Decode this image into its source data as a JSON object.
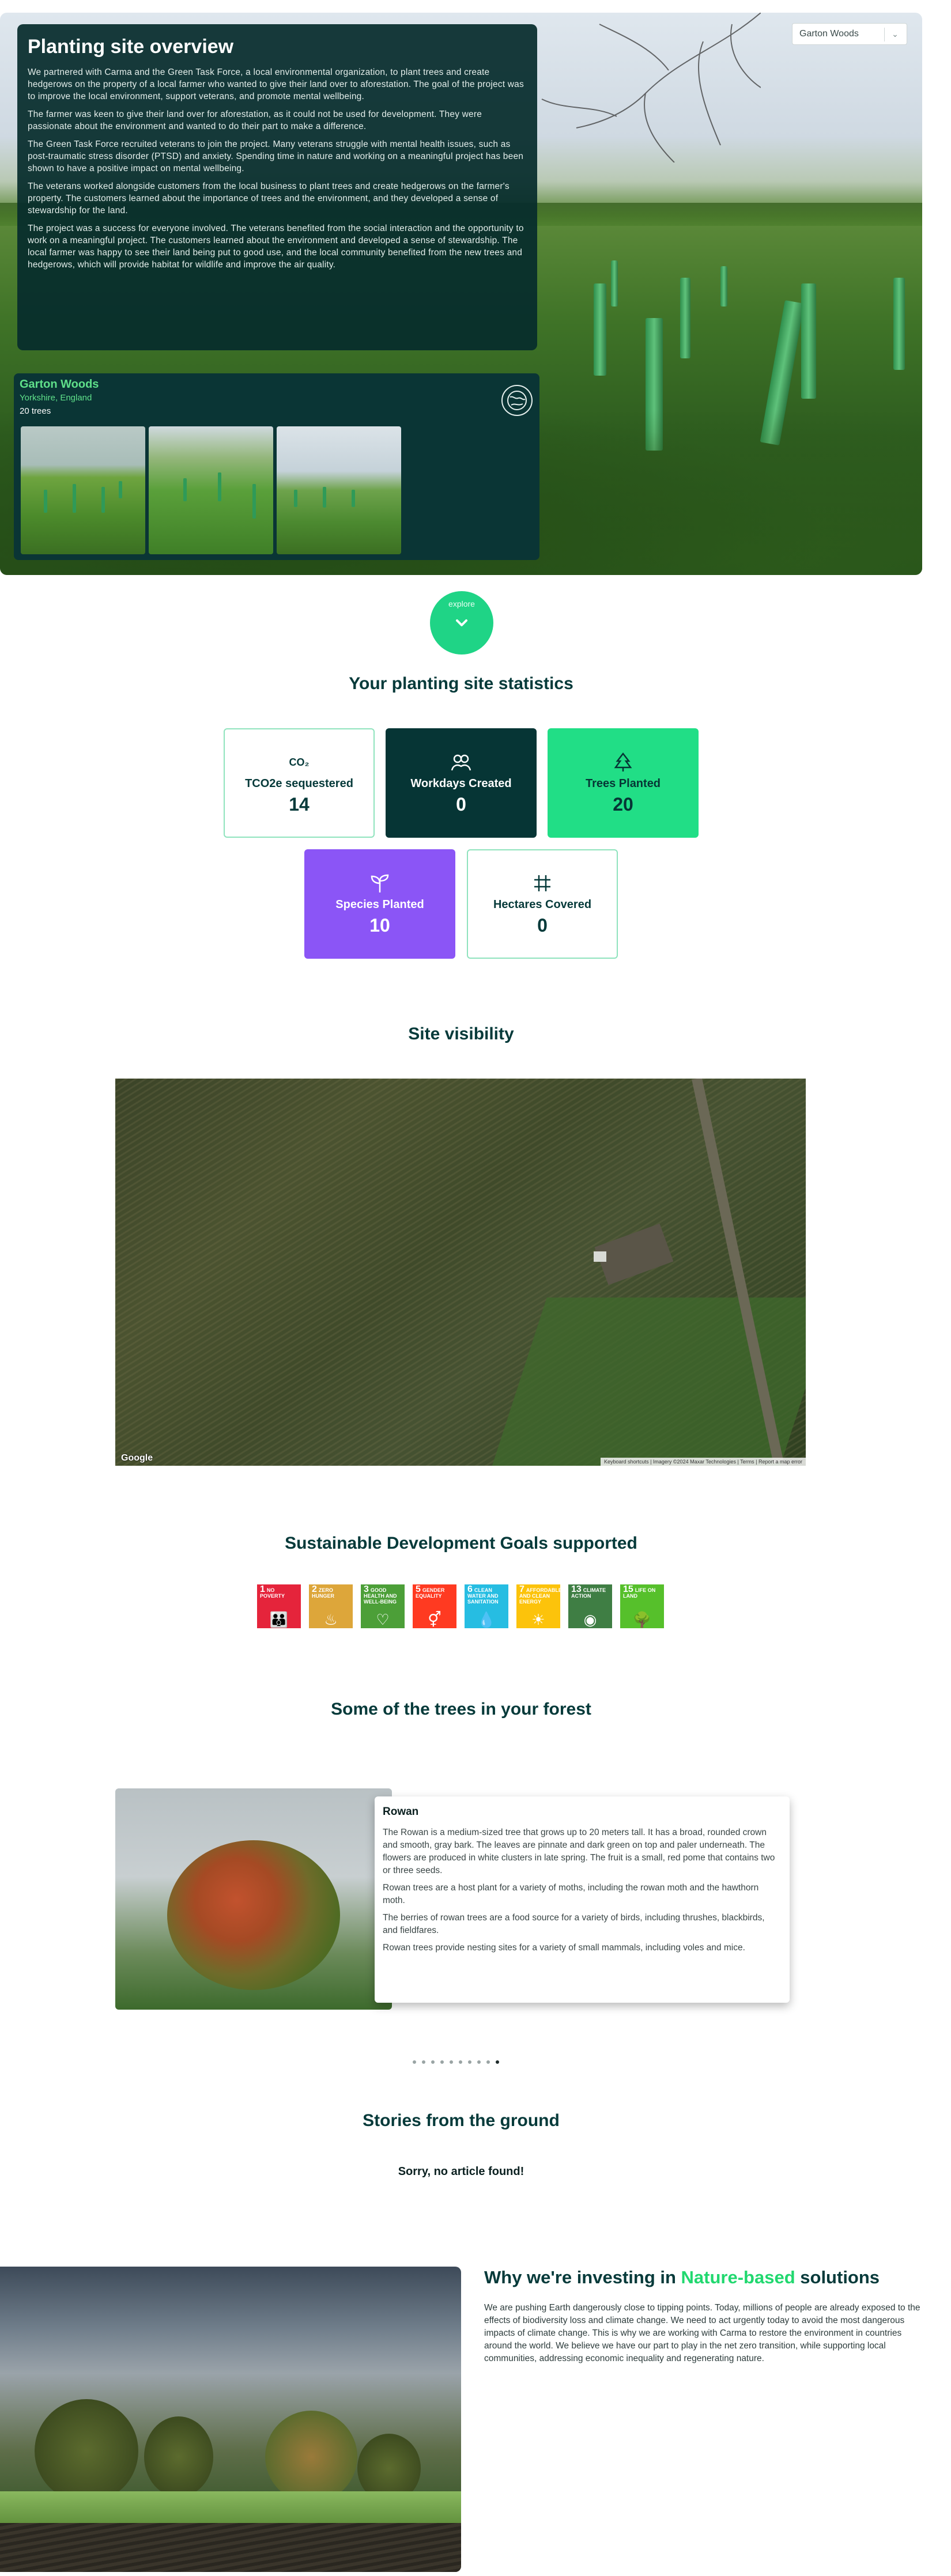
{
  "site_select": {
    "value": "Garton Woods"
  },
  "overview": {
    "title": "Planting site overview",
    "paragraphs": [
      "We partnered with Carma and the Green Task Force, a local environmental organization, to plant trees and create hedgerows on the property of a local farmer who wanted to give their land over to aforestation. The goal of the project was to improve the local environment, support veterans, and promote mental wellbeing.",
      "The farmer was keen to give their land over for aforestation, as it could not be used for development. They were passionate about the environment and wanted to do their part to make a difference.",
      "The Green Task Force recruited veterans to join the project. Many veterans struggle with mental health issues, such as post-traumatic stress disorder (PTSD) and anxiety. Spending time in nature and working on a meaningful project has been shown to have a positive impact on mental wellbeing.",
      "The veterans worked alongside customers from the local business to plant trees and create hedgerows on the farmer's property. The customers learned about the importance of trees and the environment, and they developed a sense of stewardship for the land.",
      "The project was a success for everyone involved. The veterans benefited from the social interaction and the opportunity to work on a meaningful project. The customers learned about the environment and developed a sense of stewardship. The local farmer was happy to see their land being put to good use, and the local community benefited from the new trees and hedgerows, which will provide habitat for wildlife and improve the air quality."
    ]
  },
  "site_card": {
    "name": "Garton Woods",
    "location": "Yorkshire, England",
    "trees": "20 trees",
    "globe_icon": "globe-icon"
  },
  "explore": {
    "label": "explore",
    "icon": "chevron-down-icon"
  },
  "stats": {
    "title": "Your planting site statistics",
    "items": [
      {
        "label": "TCO2e sequestered",
        "value": "14",
        "icon": "co2-icon",
        "icon_text": "CO₂"
      },
      {
        "label": "Workdays Created",
        "value": "0",
        "icon": "people-icon"
      },
      {
        "label": "Trees Planted",
        "value": "20",
        "icon": "tree-icon"
      },
      {
        "label": "Species Planted",
        "value": "10",
        "icon": "sprout-icon"
      },
      {
        "label": "Hectares Covered",
        "value": "0",
        "icon": "grid-icon"
      }
    ],
    "colors": {
      "dark": "#063535",
      "green": "#21de86",
      "purple": "#8b55f6",
      "outline": "#8fe3bd"
    }
  },
  "visibility": {
    "title": "Site visibility",
    "map_logo": "Google",
    "map_attribution": "Keyboard shortcuts  |  Imagery ©2024 Maxar Technologies  |  Terms  |  Report a map error"
  },
  "sdg": {
    "title": "Sustainable Development Goals supported",
    "goals": [
      {
        "num": "1",
        "label": "NO POVERTY",
        "color": "#e5243b",
        "glyph": "👪"
      },
      {
        "num": "2",
        "label": "ZERO HUNGER",
        "color": "#dda63a",
        "glyph": "♨"
      },
      {
        "num": "3",
        "label": "GOOD HEALTH AND WELL-BEING",
        "color": "#4c9f38",
        "glyph": "♡"
      },
      {
        "num": "5",
        "label": "GENDER EQUALITY",
        "color": "#ff3a21",
        "glyph": "⚥"
      },
      {
        "num": "6",
        "label": "CLEAN WATER AND SANITATION",
        "color": "#26bde2",
        "glyph": "💧"
      },
      {
        "num": "7",
        "label": "AFFORDABLE AND CLEAN ENERGY",
        "color": "#fcc30b",
        "glyph": "☀"
      },
      {
        "num": "13",
        "label": "CLIMATE ACTION",
        "color": "#3f7e44",
        "glyph": "◉"
      },
      {
        "num": "15",
        "label": "LIFE ON LAND",
        "color": "#56c02b",
        "glyph": "🌳"
      }
    ]
  },
  "trees": {
    "title": "Some of the trees in your forest",
    "card": {
      "name": "Rowan",
      "paragraphs": [
        "The Rowan is a medium-sized tree that grows up to 20 meters tall. It has a broad, rounded crown and smooth, gray bark. The leaves are pinnate and dark green on top and paler underneath. The flowers are produced in white clusters in late spring. The fruit is a small, red pome that contains two or three seeds.",
        "Rowan trees are a host plant for a variety of moths, including the rowan moth and the hawthorn moth.",
        "The berries of rowan trees are a food source for a variety of birds, including thrushes, blackbirds, and fieldfares.",
        "Rowan trees provide nesting sites for a variety of small mammals, including voles and mice."
      ]
    },
    "carousel_total": 10,
    "carousel_active": 9
  },
  "stories": {
    "title": "Stories from the ground",
    "empty": "Sorry, no article found!"
  },
  "why": {
    "title_pre": "Why we're investing in ",
    "title_hl": "Nature-based",
    "title_post": " solutions",
    "text": "We are pushing Earth dangerously close to tipping points. Today, millions of people are already exposed to the effects of biodiversity loss and climate change. We need to act urgently today to avoid the most dangerous impacts of climate change. This is why we are working with Carma to restore the environment in countries around the world. We believe we have our part to play in the net zero transition, while supporting local communities, addressing economic inequality and regenerating nature."
  }
}
